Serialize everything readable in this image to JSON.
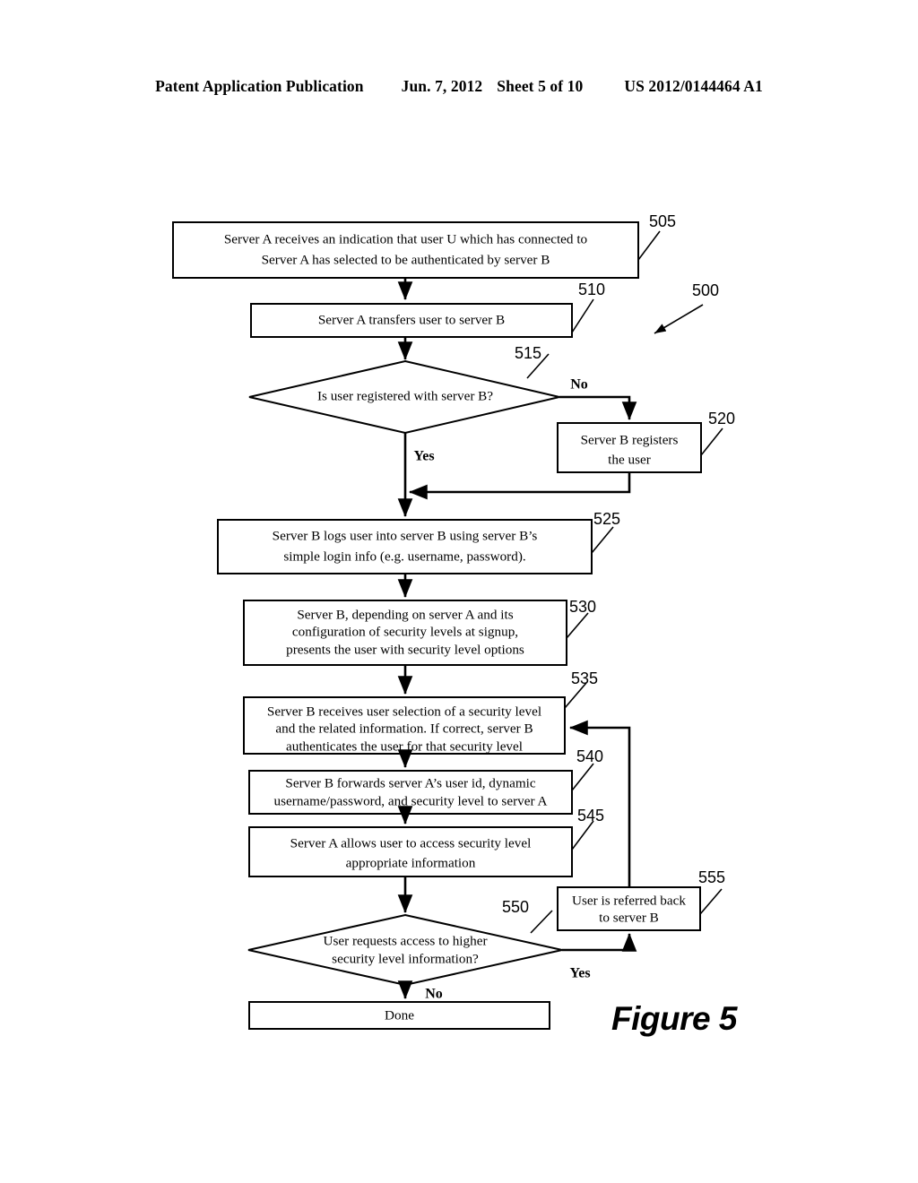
{
  "header": {
    "publication": "Patent Application Publication",
    "date": "Jun. 7, 2012",
    "sheet": "Sheet 5 of 10",
    "patent_number": "US 2012/0144464 A1"
  },
  "figure": {
    "caption": "Figure 5",
    "diagram_ref": "500"
  },
  "flowchart": {
    "nodes": [
      {
        "ref": "505",
        "type": "process",
        "lines": [
          "Server A receives an indication that user U which has connected to",
          "Server A has selected to be authenticated by server B"
        ]
      },
      {
        "ref": "510",
        "type": "process",
        "lines": [
          "Server A transfers user to server B"
        ]
      },
      {
        "ref": "515",
        "type": "decision",
        "lines": [
          "Is user registered with server B?"
        ]
      },
      {
        "ref": "520",
        "type": "process",
        "lines": [
          "Server B registers",
          "the user"
        ]
      },
      {
        "ref": "525",
        "type": "process",
        "lines": [
          "Server B logs user into server B using server B’s",
          "simple login info (e.g. username, password)."
        ]
      },
      {
        "ref": "530",
        "type": "process",
        "lines": [
          "Server B, depending on server A and its",
          "configuration of security levels at signup,",
          "presents the user with security level options"
        ]
      },
      {
        "ref": "535",
        "type": "process",
        "lines": [
          "Server B receives user selection of a security level",
          "and the related information. If correct, server B",
          "authenticates the user for that security level"
        ]
      },
      {
        "ref": "540",
        "type": "process",
        "lines": [
          "Server B forwards server A’s user id, dynamic",
          "username/password, and security level to server A"
        ]
      },
      {
        "ref": "545",
        "type": "process",
        "lines": [
          "Server A allows user to access security level",
          "appropriate information"
        ]
      },
      {
        "ref": "550",
        "type": "decision",
        "lines": [
          "User requests access to higher",
          "security level information?"
        ]
      },
      {
        "ref": "555",
        "type": "process",
        "lines": [
          "User is referred back",
          "to server B"
        ]
      },
      {
        "ref": "",
        "type": "terminal",
        "lines": [
          "Done"
        ]
      }
    ],
    "branch_labels": {
      "d515_no": "No",
      "d515_yes": "Yes",
      "d550_yes": "Yes",
      "d550_no": "No"
    }
  }
}
